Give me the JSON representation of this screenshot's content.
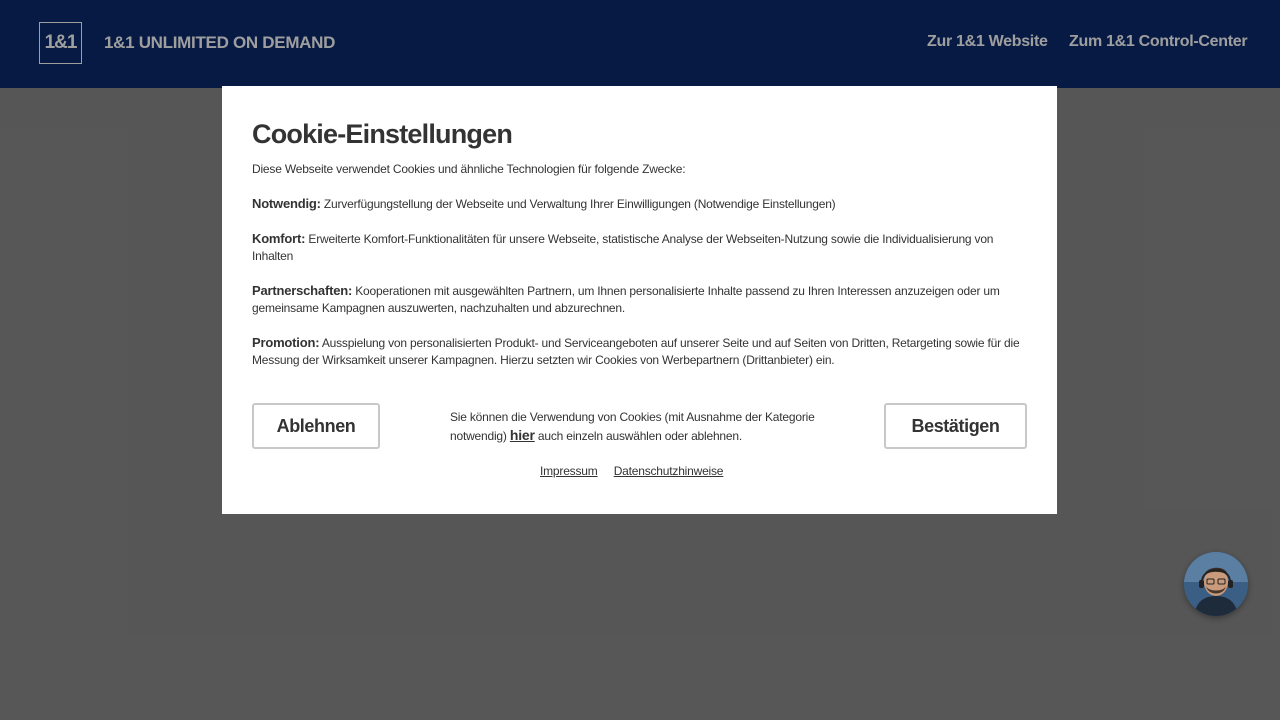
{
  "header": {
    "logo_text": "1&1",
    "brand_title": "1&1 UNLIMITED ON DEMAND",
    "links": {
      "website": "Zur 1&1 Website",
      "control_center": "Zum 1&1 Control-Center"
    }
  },
  "cookie_modal": {
    "title": "Cookie-Einstellungen",
    "intro": "Diese Webseite verwendet Cookies und ähnliche Technologien für folgende Zwecke:",
    "purposes": [
      {
        "name": "Notwendig:",
        "description": "Zurverfügungstellung der Webseite und Verwaltung Ihrer Einwilligungen (Notwendige Einstellungen)"
      },
      {
        "name": "Komfort:",
        "description": "Erweiterte Komfort-Funktionalitäten für unsere Webseite, statistische Analyse der Webseiten-Nutzung sowie die Individualisierung von Inhalten"
      },
      {
        "name": "Partnerschaften:",
        "description": "Kooperationen mit ausgewählten Partnern, um Ihnen personalisierte Inhalte passend zu Ihren Interessen anzuzeigen oder um gemeinsame Kampagnen auszuwerten, nachzuhalten und abzurechnen."
      },
      {
        "name": "Promotion:",
        "description": "Ausspielung von personalisierten Produkt- und Serviceangeboten auf unserer Seite und auf Seiten von Dritten, Retargeting sowie für die Messung der Wirksamkeit unserer Kampagnen. Hierzu setzten wir Cookies von Werbepartnern (Drittanbieter) ein."
      }
    ],
    "reject_label": "Ablehnen",
    "confirm_label": "Bestätigen",
    "choice_text_before": "Sie können die Verwendung von Cookies (mit Ausnahme der Kategorie notwendig)",
    "choice_link": "hier",
    "choice_text_after": "auch einzeln auswählen oder ablehnen.",
    "footer_links": {
      "imprint": "Impressum",
      "privacy": "Datenschutzhinweise"
    }
  },
  "colors": {
    "header_bg": "#0b2a6f",
    "page_bg": "#8c8c8c",
    "modal_bg": "#ffffff",
    "text": "#333333"
  },
  "icons": {
    "chat_avatar": "support-agent-avatar-icon"
  }
}
